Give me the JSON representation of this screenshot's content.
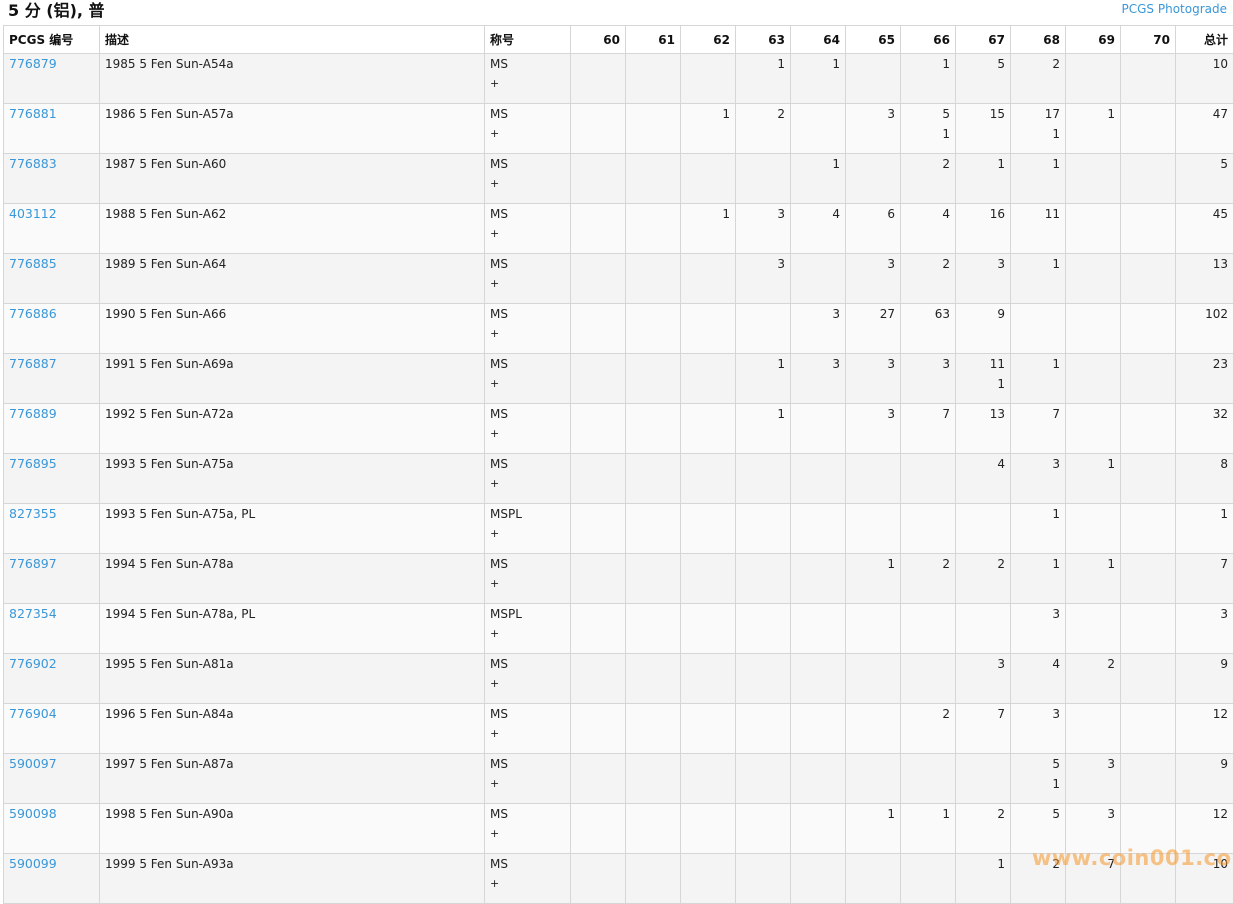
{
  "header": {
    "title": "5 分 (铝), 普",
    "photograde_link": "PCGS Photograde"
  },
  "table": {
    "columns": [
      "PCGS 编号",
      "描述",
      "称号",
      "60",
      "61",
      "62",
      "63",
      "64",
      "65",
      "66",
      "67",
      "68",
      "69",
      "70",
      "总计"
    ],
    "rows": [
      {
        "pcgs": "776879",
        "desc": "1985 5 Fen Sun-A54a",
        "grade": "MS",
        "plus": "+",
        "g60": "",
        "g61": "",
        "g62": "",
        "g63": "1",
        "g64": "1",
        "g65": "",
        "g66": "1",
        "g67": "5",
        "g68": "2",
        "g69": "",
        "g70": "",
        "total": "10",
        "p60": "",
        "p61": "",
        "p62": "",
        "p63": "",
        "p64": "",
        "p65": "",
        "p66": "",
        "p67": "",
        "p68": "",
        "p69": "",
        "p70": ""
      },
      {
        "pcgs": "776881",
        "desc": "1986 5 Fen Sun-A57a",
        "grade": "MS",
        "plus": "+",
        "g60": "",
        "g61": "",
        "g62": "1",
        "g63": "2",
        "g64": "",
        "g65": "3",
        "g66": "5",
        "g67": "15",
        "g68": "17",
        "g69": "1",
        "g70": "",
        "total": "47",
        "p60": "",
        "p61": "",
        "p62": "",
        "p63": "",
        "p64": "",
        "p65": "",
        "p66": "1",
        "p67": "",
        "p68": "1",
        "p69": "",
        "p70": ""
      },
      {
        "pcgs": "776883",
        "desc": "1987 5 Fen Sun-A60",
        "grade": "MS",
        "plus": "+",
        "g60": "",
        "g61": "",
        "g62": "",
        "g63": "",
        "g64": "1",
        "g65": "",
        "g66": "2",
        "g67": "1",
        "g68": "1",
        "g69": "",
        "g70": "",
        "total": "5",
        "p60": "",
        "p61": "",
        "p62": "",
        "p63": "",
        "p64": "",
        "p65": "",
        "p66": "",
        "p67": "",
        "p68": "",
        "p69": "",
        "p70": ""
      },
      {
        "pcgs": "403112",
        "desc": "1988 5 Fen Sun-A62",
        "grade": "MS",
        "plus": "+",
        "g60": "",
        "g61": "",
        "g62": "1",
        "g63": "3",
        "g64": "4",
        "g65": "6",
        "g66": "4",
        "g67": "16",
        "g68": "11",
        "g69": "",
        "g70": "",
        "total": "45",
        "p60": "",
        "p61": "",
        "p62": "",
        "p63": "",
        "p64": "",
        "p65": "",
        "p66": "",
        "p67": "",
        "p68": "",
        "p69": "",
        "p70": ""
      },
      {
        "pcgs": "776885",
        "desc": "1989 5 Fen Sun-A64",
        "grade": "MS",
        "plus": "+",
        "g60": "",
        "g61": "",
        "g62": "",
        "g63": "3",
        "g64": "",
        "g65": "3",
        "g66": "2",
        "g67": "3",
        "g68": "1",
        "g69": "",
        "g70": "",
        "total": "13",
        "p60": "",
        "p61": "",
        "p62": "",
        "p63": "",
        "p64": "",
        "p65": "",
        "p66": "",
        "p67": "",
        "p68": "",
        "p69": "",
        "p70": ""
      },
      {
        "pcgs": "776886",
        "desc": "1990 5 Fen Sun-A66",
        "grade": "MS",
        "plus": "+",
        "g60": "",
        "g61": "",
        "g62": "",
        "g63": "",
        "g64": "3",
        "g65": "27",
        "g66": "63",
        "g67": "9",
        "g68": "",
        "g69": "",
        "g70": "",
        "total": "102",
        "p60": "",
        "p61": "",
        "p62": "",
        "p63": "",
        "p64": "",
        "p65": "",
        "p66": "",
        "p67": "",
        "p68": "",
        "p69": "",
        "p70": ""
      },
      {
        "pcgs": "776887",
        "desc": "1991 5 Fen Sun-A69a",
        "grade": "MS",
        "plus": "+",
        "g60": "",
        "g61": "",
        "g62": "",
        "g63": "1",
        "g64": "3",
        "g65": "3",
        "g66": "3",
        "g67": "11",
        "g68": "1",
        "g69": "",
        "g70": "",
        "total": "23",
        "p60": "",
        "p61": "",
        "p62": "",
        "p63": "",
        "p64": "",
        "p65": "",
        "p66": "",
        "p67": "1",
        "p68": "",
        "p69": "",
        "p70": ""
      },
      {
        "pcgs": "776889",
        "desc": "1992 5 Fen Sun-A72a",
        "grade": "MS",
        "plus": "+",
        "g60": "",
        "g61": "",
        "g62": "",
        "g63": "1",
        "g64": "",
        "g65": "3",
        "g66": "7",
        "g67": "13",
        "g68": "7",
        "g69": "",
        "g70": "",
        "total": "32",
        "p60": "",
        "p61": "",
        "p62": "",
        "p63": "",
        "p64": "",
        "p65": "",
        "p66": "",
        "p67": "",
        "p68": "",
        "p69": "",
        "p70": ""
      },
      {
        "pcgs": "776895",
        "desc": "1993 5 Fen Sun-A75a",
        "grade": "MS",
        "plus": "+",
        "g60": "",
        "g61": "",
        "g62": "",
        "g63": "",
        "g64": "",
        "g65": "",
        "g66": "",
        "g67": "4",
        "g68": "3",
        "g69": "1",
        "g70": "",
        "total": "8",
        "p60": "",
        "p61": "",
        "p62": "",
        "p63": "",
        "p64": "",
        "p65": "",
        "p66": "",
        "p67": "",
        "p68": "",
        "p69": "",
        "p70": ""
      },
      {
        "pcgs": "827355",
        "desc": "1993 5 Fen Sun-A75a, PL",
        "grade": "MSPL",
        "plus": "+",
        "g60": "",
        "g61": "",
        "g62": "",
        "g63": "",
        "g64": "",
        "g65": "",
        "g66": "",
        "g67": "",
        "g68": "1",
        "g69": "",
        "g70": "",
        "total": "1",
        "p60": "",
        "p61": "",
        "p62": "",
        "p63": "",
        "p64": "",
        "p65": "",
        "p66": "",
        "p67": "",
        "p68": "",
        "p69": "",
        "p70": ""
      },
      {
        "pcgs": "776897",
        "desc": "1994 5 Fen Sun-A78a",
        "grade": "MS",
        "plus": "+",
        "g60": "",
        "g61": "",
        "g62": "",
        "g63": "",
        "g64": "",
        "g65": "1",
        "g66": "2",
        "g67": "2",
        "g68": "1",
        "g69": "1",
        "g70": "",
        "total": "7",
        "p60": "",
        "p61": "",
        "p62": "",
        "p63": "",
        "p64": "",
        "p65": "",
        "p66": "",
        "p67": "",
        "p68": "",
        "p69": "",
        "p70": ""
      },
      {
        "pcgs": "827354",
        "desc": "1994 5 Fen Sun-A78a, PL",
        "grade": "MSPL",
        "plus": "+",
        "g60": "",
        "g61": "",
        "g62": "",
        "g63": "",
        "g64": "",
        "g65": "",
        "g66": "",
        "g67": "",
        "g68": "3",
        "g69": "",
        "g70": "",
        "total": "3",
        "p60": "",
        "p61": "",
        "p62": "",
        "p63": "",
        "p64": "",
        "p65": "",
        "p66": "",
        "p67": "",
        "p68": "",
        "p69": "",
        "p70": ""
      },
      {
        "pcgs": "776902",
        "desc": "1995 5 Fen Sun-A81a",
        "grade": "MS",
        "plus": "+",
        "g60": "",
        "g61": "",
        "g62": "",
        "g63": "",
        "g64": "",
        "g65": "",
        "g66": "",
        "g67": "3",
        "g68": "4",
        "g69": "2",
        "g70": "",
        "total": "9",
        "p60": "",
        "p61": "",
        "p62": "",
        "p63": "",
        "p64": "",
        "p65": "",
        "p66": "",
        "p67": "",
        "p68": "",
        "p69": "",
        "p70": ""
      },
      {
        "pcgs": "776904",
        "desc": "1996 5 Fen Sun-A84a",
        "grade": "MS",
        "plus": "+",
        "g60": "",
        "g61": "",
        "g62": "",
        "g63": "",
        "g64": "",
        "g65": "",
        "g66": "2",
        "g67": "7",
        "g68": "3",
        "g69": "",
        "g70": "",
        "total": "12",
        "p60": "",
        "p61": "",
        "p62": "",
        "p63": "",
        "p64": "",
        "p65": "",
        "p66": "",
        "p67": "",
        "p68": "",
        "p69": "",
        "p70": ""
      },
      {
        "pcgs": "590097",
        "desc": "1997 5 Fen Sun-A87a",
        "grade": "MS",
        "plus": "+",
        "g60": "",
        "g61": "",
        "g62": "",
        "g63": "",
        "g64": "",
        "g65": "",
        "g66": "",
        "g67": "",
        "g68": "5",
        "g69": "3",
        "g70": "",
        "total": "9",
        "p60": "",
        "p61": "",
        "p62": "",
        "p63": "",
        "p64": "",
        "p65": "",
        "p66": "",
        "p67": "",
        "p68": "1",
        "p69": "",
        "p70": ""
      },
      {
        "pcgs": "590098",
        "desc": "1998 5 Fen Sun-A90a",
        "grade": "MS",
        "plus": "+",
        "g60": "",
        "g61": "",
        "g62": "",
        "g63": "",
        "g64": "",
        "g65": "1",
        "g66": "1",
        "g67": "2",
        "g68": "5",
        "g69": "3",
        "g70": "",
        "total": "12",
        "p60": "",
        "p61": "",
        "p62": "",
        "p63": "",
        "p64": "",
        "p65": "",
        "p66": "",
        "p67": "",
        "p68": "",
        "p69": "",
        "p70": ""
      },
      {
        "pcgs": "590099",
        "desc": "1999 5 Fen Sun-A93a",
        "grade": "MS",
        "plus": "+",
        "g60": "",
        "g61": "",
        "g62": "",
        "g63": "",
        "g64": "",
        "g65": "",
        "g66": "",
        "g67": "1",
        "g68": "2",
        "g69": "7",
        "g70": "",
        "total": "10",
        "p60": "",
        "p61": "",
        "p62": "",
        "p63": "",
        "p64": "",
        "p65": "",
        "p66": "",
        "p67": "",
        "p68": "",
        "p69": "",
        "p70": ""
      }
    ]
  },
  "watermark": "www.coin001.com",
  "colors": {
    "link": "#3a97d8",
    "border": "#d6d6d6",
    "row_alt": "#f4f4f4"
  }
}
